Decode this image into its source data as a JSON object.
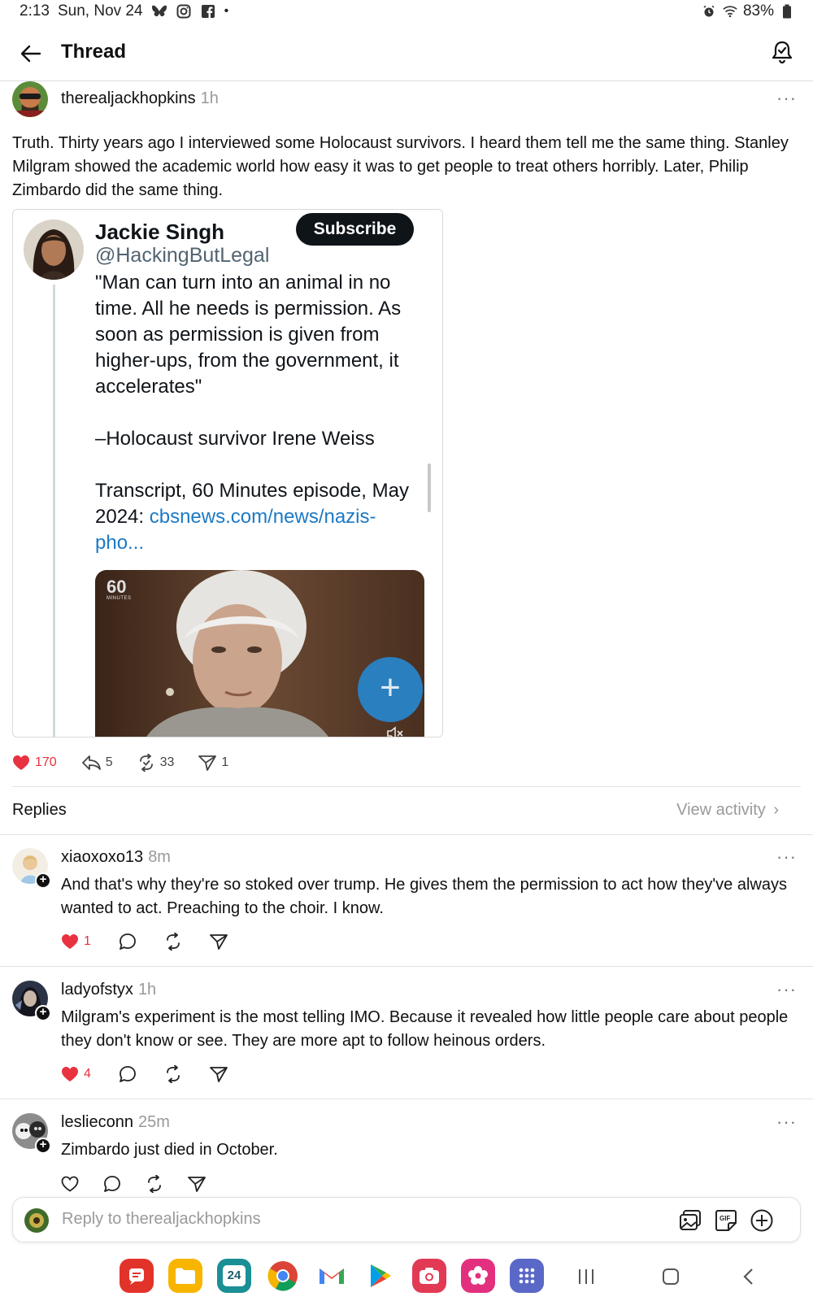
{
  "status_bar": {
    "time": "2:13",
    "date": "Sun, Nov 24",
    "battery": "83%",
    "icons": [
      "bluesky-icon",
      "instagram-icon",
      "facebook-icon",
      "alarm-icon",
      "wifi-icon",
      "battery-icon"
    ]
  },
  "header": {
    "title": "Thread"
  },
  "post": {
    "username": "therealjackhopkins",
    "time": "1h",
    "text": "Truth. Thirty years ago I interviewed some Holocaust survivors. I heard them tell me the same thing. Stanley Milgram showed the academic world how easy it was to get people to treat others horribly. Later, Philip Zimbardo did the same thing.",
    "embed": {
      "name": "Jackie Singh",
      "handle": "@HackingButLegal",
      "subscribe_label": "Subscribe",
      "quote": "\"Man can turn into an animal in no time. All he needs is permission. As soon as permission is given from higher-ups, from the government, it accelerates\"",
      "attribution": "–Holocaust survivor Irene Weiss",
      "source_prefix": "Transcript, 60 Minutes episode, May 2024: ",
      "source_link": "cbsnews.com/news/nazis-pho...",
      "video_logo": "60",
      "video_logo_sub": "MINUTES"
    },
    "likes": "170",
    "replies": "5",
    "reposts": "33",
    "shares": "1"
  },
  "replies_section": {
    "label": "Replies",
    "view_activity": "View activity"
  },
  "replies": [
    {
      "username": "xiaoxoxo13",
      "time": "8m",
      "text": "And that's why they're so stoked over trump. He gives them the permission to act how they've always wanted to act. Preaching to the choir. I know.",
      "likes": "1",
      "liked": true
    },
    {
      "username": "ladyofstyx",
      "time": "1h",
      "text": "Milgram's experiment is the most telling IMO. Because it revealed how little people care about people they don't know or see. They are more apt to follow heinous orders.",
      "likes": "4",
      "liked": true
    },
    {
      "username": "leslieconn",
      "time": "25m",
      "text": "Zimbardo just died in October.",
      "likes": "",
      "liked": false
    }
  ],
  "reply_input": {
    "placeholder": "Reply to therealjackhopkins"
  },
  "dock": {
    "calendar_day": "24"
  },
  "colors": {
    "like_red": "#e8323f",
    "link_blue": "#1d79c4",
    "subscribe_bg": "#0f1419"
  }
}
